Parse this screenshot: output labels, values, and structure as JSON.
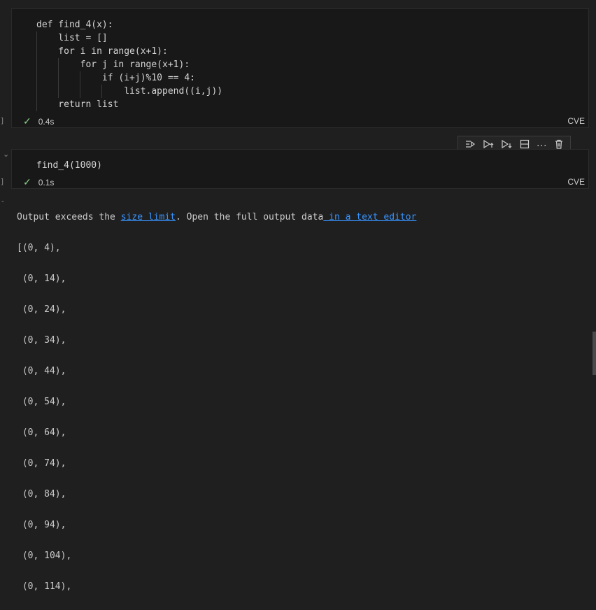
{
  "cell1": {
    "code_lines": [
      "def find_4(x):",
      "    list = []",
      "    for i in range(x+1):",
      "        for j in range(x+1):",
      "            if (i+j)%10 == 4:",
      "                list.append((i,j))",
      "    return list"
    ],
    "gutter": "]",
    "exec_time": "0.4s",
    "language": "CVE"
  },
  "cell2": {
    "code": "find_4(1000)",
    "gutter": "]",
    "exec_time": "0.1s",
    "language": "CVE"
  },
  "toolbar": {
    "icons": [
      "run-by-line-icon",
      "execute-above-icon",
      "execute-below-icon",
      "split-cell-icon",
      "more-icon",
      "delete-icon"
    ]
  },
  "output": {
    "notice_prefix": "Output exceeds the ",
    "size_limit_link": "size limit",
    "notice_middle": ". Open the full output data",
    "text_editor_link": " in a text editor",
    "lines": [
      "[(0, 4),",
      " (0, 14),",
      " (0, 24),",
      " (0, 34),",
      " (0, 44),",
      " (0, 54),",
      " (0, 64),",
      " (0, 74),",
      " (0, 84),",
      " (0, 94),",
      " (0, 104),",
      " (0, 114),"
    ]
  }
}
